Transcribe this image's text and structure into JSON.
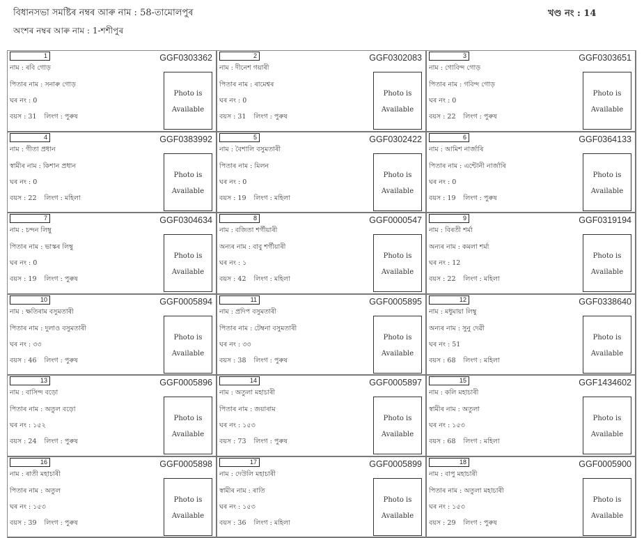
{
  "header": {
    "assembly": "বিধানসভা সমষ্টিৰ নম্বৰ আৰু নাম : 58-তামোলপুৰ",
    "section": "অংশৰ নম্বৰ আৰু নাম : 1-শশীপুৰ",
    "part_no": "খণ্ড নং : 14"
  },
  "labels": {
    "house": "ঘৰ নং :",
    "age": "বয়স :",
    "gender": "লিংগ :",
    "photo_line1": "Photo is",
    "photo_line2": "Available"
  },
  "voters": [
    {
      "serial": "1",
      "epic": "GGF0303362",
      "name": "নাম : ৰবি গোড়",
      "relation": "পিতাৰ নাম : সনাৰু গোড়",
      "house": "0",
      "age": "31",
      "gender": "পুৰুষ"
    },
    {
      "serial": "2",
      "epic": "GGF0302083",
      "name": "নাম : দীনেশ গয়াৰী",
      "relation": "পিতাৰ নাম : ৰামেশ্বৰ",
      "house": "0",
      "age": "31",
      "gender": "পুৰুষ"
    },
    {
      "serial": "3",
      "epic": "GGF0303651",
      "name": "নাম : গোবিন্দ গোড়",
      "relation": "পিতাৰ নাম : গবিন্দ গোড়",
      "house": "0",
      "age": "22",
      "gender": "পুৰুষ"
    },
    {
      "serial": "4",
      "epic": "GGF0383992",
      "name": "নাম : গীতা প্ৰধান",
      "relation": "স্বামীৰ নাম : কিশান প্ৰধান",
      "house": "0",
      "age": "22",
      "gender": "মহিলা"
    },
    {
      "serial": "5",
      "epic": "GGF0302422",
      "name": "নাম : বৈশালি বসুমতাৰী",
      "relation": "পিতাৰ নাম : মিলন",
      "house": "0",
      "age": "19",
      "gender": "মহিলা"
    },
    {
      "serial": "6",
      "epic": "GGF0364133",
      "name": "নাম : আমিশ নাৰ্জাৰি",
      "relation": "পিতাৰ নাম : এন্টোনী নাৰ্জাৰি",
      "house": "0",
      "age": "19",
      "gender": "পুৰুষ"
    },
    {
      "serial": "7",
      "epic": "GGF0304634",
      "name": "নাম : চন্দন লিম্বু",
      "relation": "পিতাৰ নাম : ভাস্কৰ লিম্বু",
      "house": "0",
      "age": "19",
      "gender": "পুৰুষ"
    },
    {
      "serial": "8",
      "epic": "GGF0000547",
      "name": "নাম : বজিতা শৰ্গীয়াৰী",
      "relation": "অন্যৰ নাম : বাবু শৰ্গীয়াৰী",
      "house": "১",
      "age": "42",
      "gender": "মহিলা"
    },
    {
      "serial": "9",
      "epic": "GGF0319194",
      "name": "নাম : বিৰতী শৰ্মা",
      "relation": "অন্যৰ নাম : কমলা শৰ্মা",
      "house": "12",
      "age": "22",
      "gender": "মহিলা"
    },
    {
      "serial": "10",
      "epic": "GGF0005894",
      "name": "নাম : ক্ষতিৰাম বসুমতাৰী",
      "relation": "পিতাৰ নাম : দুলাও বসুমতাৰী",
      "house": "৩৩",
      "age": "46",
      "gender": "পুৰুষ"
    },
    {
      "serial": "11",
      "epic": "GGF0005895",
      "name": "নাম : প্ৰদিপ বসুমতাৰী",
      "relation": "পিতাৰ নাম : টেম্বনা বসুমতাৰী",
      "house": "৩৩",
      "age": "38",
      "gender": "পুৰুষ"
    },
    {
      "serial": "12",
      "epic": "GGF0338640",
      "name": "নাম : মধুমায়া লিম্বু",
      "relation": "অন্যৰ নাম : সুনু দেৱী",
      "house": "51",
      "age": "68",
      "gender": "মহিলা"
    },
    {
      "serial": "13",
      "epic": "GGF0005896",
      "name": "নাম : বাসিন্দ বড়ো",
      "relation": "পিতাৰ নাম : অতুল বড়ো",
      "house": "১৫২",
      "age": "24",
      "gender": "পুৰুষ"
    },
    {
      "serial": "14",
      "epic": "GGF0005897",
      "name": "নাম : অতুলা মহাচাৰী",
      "relation": "পিতাৰ নাম : জয়াৰাম",
      "house": "১৫৩",
      "age": "73",
      "gender": "পুৰুষ"
    },
    {
      "serial": "15",
      "epic": "GGF1434602",
      "name": "নাম : কলি মহাচাৰী",
      "relation": "স্বামীৰ নাম : অতুলা",
      "house": "১৫৩",
      "age": "68",
      "gender": "মহিলা"
    },
    {
      "serial": "16",
      "epic": "GGF0005898",
      "name": "নাম : ৰাতী মহাচাৰী",
      "relation": "পিতাৰ নাম : অতুল",
      "house": "১৫৩",
      "age": "39",
      "gender": "পুৰুষ"
    },
    {
      "serial": "17",
      "epic": "GGF0005899",
      "name": "নাম : দেউলি মহাচাৰী",
      "relation": "স্বামীৰ নাম : ৰাতি",
      "house": "১৫৩",
      "age": "36",
      "gender": "মহিলা"
    },
    {
      "serial": "18",
      "epic": "GGF0005900",
      "name": "নাম : বাপু মহাচাৰী",
      "relation": "পিতাৰ নাম : অতুলা মহাচাৰী",
      "house": "১৫৩",
      "age": "29",
      "gender": "পুৰুষ"
    }
  ]
}
